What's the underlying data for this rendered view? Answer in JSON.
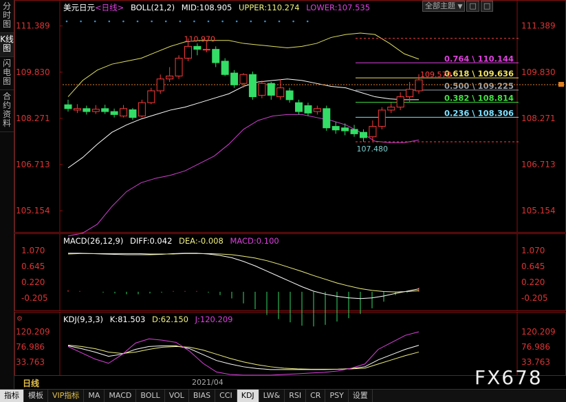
{
  "left_tabs": [
    {
      "label": "分时图",
      "active": false
    },
    {
      "label": "K线图",
      "active": true
    },
    {
      "label": "闪电图",
      "active": false
    },
    {
      "label": "合约资料",
      "active": false
    }
  ],
  "top_controls": {
    "theme_select": "全部主题",
    "chevron": "▼",
    "btn1": "□",
    "btn2": "□"
  },
  "main_panel": {
    "symbol": "美元日元",
    "period_tag": "<日线>",
    "boll_label": "BOLL(21,2)",
    "mid_label": "MID:108.905",
    "upper_label": "UPPER:110.274",
    "lower_label": "LOWER:107.535",
    "y_ticks": [
      "111.389",
      "109.830",
      "108.271",
      "106.713",
      "105.154"
    ],
    "high_annotation": "110.970",
    "low_annotation": "107.480",
    "last_price_label": "109.570"
  },
  "fib_levels": [
    {
      "label": "0.764 \\ 110.144",
      "color": "#e040e0"
    },
    {
      "label": "0.618 \\ 109.636",
      "color": "#f0e060"
    },
    {
      "label": "0.500 \\ 109.225",
      "color": "#9aa0a8"
    },
    {
      "label": "0.382 \\ 108.814",
      "color": "#40e040"
    },
    {
      "label": "0.236 \\ 108.306",
      "color": "#7fe0ff"
    }
  ],
  "macd_panel": {
    "title": "MACD(26,12,9)",
    "diff": "DIFF:0.042",
    "dea": "DEA:-0.008",
    "macd": "MACD:0.100",
    "y_ticks": [
      "1.070",
      "0.645",
      "0.220",
      "-0.205"
    ]
  },
  "kdj_panel": {
    "title": "KDJ(9,3,3)",
    "k": "K:81.503",
    "d": "D:62.150",
    "j": "J:120.209",
    "y_ticks": [
      "120.209",
      "76.986",
      "33.763"
    ]
  },
  "period_label": "日线",
  "date_label": "2021/04",
  "bottom_tabs": [
    {
      "label": "指标",
      "active": true,
      "vip": false
    },
    {
      "label": "模板",
      "active": false,
      "vip": false
    },
    {
      "label": "VIP指标",
      "active": false,
      "vip": true
    },
    {
      "label": "MA",
      "active": false,
      "vip": false
    },
    {
      "label": "MACD",
      "active": false,
      "vip": false
    },
    {
      "label": "BOLL",
      "active": false,
      "vip": false
    },
    {
      "label": "VOL",
      "active": false,
      "vip": false
    },
    {
      "label": "BIAS",
      "active": false,
      "vip": false
    },
    {
      "label": "CCI",
      "active": false,
      "vip": false
    },
    {
      "label": "KDJ",
      "active": true,
      "vip": false
    },
    {
      "label": "LW&",
      "active": false,
      "vip": false
    },
    {
      "label": "RSI",
      "active": false,
      "vip": false
    },
    {
      "label": "CR",
      "active": false,
      "vip": false
    },
    {
      "label": "PSY",
      "active": false,
      "vip": false
    },
    {
      "label": "设置",
      "active": false,
      "vip": false
    }
  ],
  "watermark": "FX678",
  "colors": {
    "up": "#ff3a3a",
    "down": "#33dd66",
    "mid": "#ffffff",
    "upper": "#e0e060",
    "lower": "#d040d0",
    "diff": "#ffffff",
    "dea": "#f0f080",
    "macd": "#e040e0",
    "k": "#ffffff",
    "d": "#f0f080",
    "j": "#e040e0"
  },
  "chart_data": [
    {
      "type": "candlestick",
      "title": "美元日元<日线>",
      "ylim": [
        104.6,
        111.8
      ],
      "y_ticks": [
        111.389,
        109.83,
        108.271,
        106.713,
        105.154
      ],
      "candles": [
        [
          108.73,
          108.6,
          108.9,
          108.5
        ],
        [
          108.55,
          108.6,
          108.75,
          108.45
        ],
        [
          108.6,
          108.5,
          108.7,
          108.4
        ],
        [
          108.5,
          108.58,
          108.72,
          108.42
        ],
        [
          108.6,
          108.5,
          108.73,
          108.42
        ],
        [
          108.5,
          108.4,
          108.6,
          108.3
        ],
        [
          108.35,
          108.6,
          108.72,
          108.3
        ],
        [
          108.56,
          108.3,
          108.62,
          108.22
        ],
        [
          108.35,
          108.8,
          108.9,
          108.3
        ],
        [
          108.8,
          109.2,
          109.3,
          108.75
        ],
        [
          109.2,
          109.6,
          109.75,
          109.1
        ],
        [
          109.6,
          109.7,
          110.0,
          109.5
        ],
        [
          109.7,
          110.3,
          110.4,
          109.6
        ],
        [
          110.3,
          110.7,
          110.97,
          110.2
        ],
        [
          110.7,
          110.6,
          110.8,
          110.4
        ],
        [
          110.6,
          110.6,
          110.9,
          110.5
        ],
        [
          110.6,
          110.15,
          110.7,
          110.0
        ],
        [
          110.2,
          109.75,
          110.3,
          109.7
        ],
        [
          109.8,
          109.4,
          109.9,
          109.3
        ],
        [
          109.45,
          109.75,
          109.8,
          109.3
        ],
        [
          109.75,
          109.0,
          109.85,
          108.9
        ],
        [
          109.05,
          109.45,
          109.55,
          108.95
        ],
        [
          109.45,
          109.05,
          109.5,
          108.9
        ],
        [
          109.0,
          109.3,
          109.6,
          108.9
        ],
        [
          109.2,
          108.9,
          109.3,
          108.8
        ],
        [
          108.8,
          108.5,
          108.9,
          108.4
        ],
        [
          108.7,
          108.45,
          108.8,
          108.35
        ],
        [
          108.5,
          108.6,
          108.7,
          108.4
        ],
        [
          108.6,
          107.95,
          108.7,
          107.85
        ],
        [
          108.0,
          107.88,
          108.15,
          107.75
        ],
        [
          107.95,
          107.85,
          108.1,
          107.7
        ],
        [
          107.9,
          107.75,
          108.05,
          107.65
        ],
        [
          107.8,
          107.62,
          107.9,
          107.48
        ],
        [
          107.65,
          108.0,
          108.2,
          107.5
        ],
        [
          108.0,
          108.55,
          108.65,
          107.9
        ],
        [
          108.55,
          108.65,
          108.8,
          108.45
        ],
        [
          108.65,
          109.0,
          109.15,
          108.55
        ],
        [
          109.0,
          109.25,
          109.5,
          108.8
        ],
        [
          109.2,
          109.57,
          109.76,
          109.1
        ]
      ],
      "bollinger": {
        "mid": [
          106.6,
          106.95,
          107.4,
          107.8,
          108.05,
          108.25,
          108.4,
          108.55,
          108.65,
          108.8,
          108.95,
          109.1,
          109.35,
          109.5,
          109.55,
          109.6,
          109.55,
          109.45,
          109.35,
          109.3,
          109.15,
          109.0,
          108.93,
          108.9,
          108.9
        ],
        "upper": [
          109.0,
          109.55,
          109.9,
          110.1,
          110.2,
          110.3,
          110.5,
          110.7,
          110.85,
          110.9,
          110.9,
          110.9,
          110.8,
          110.75,
          110.7,
          110.65,
          110.7,
          110.8,
          111.0,
          111.1,
          111.15,
          111.1,
          110.8,
          110.45,
          110.27
        ],
        "lower": [
          104.3,
          104.4,
          104.7,
          105.3,
          105.8,
          106.1,
          106.25,
          106.35,
          106.5,
          106.75,
          107.0,
          107.4,
          107.9,
          108.2,
          108.35,
          108.4,
          108.4,
          108.3,
          108.2,
          108.05,
          107.8,
          107.5,
          107.45,
          107.45,
          107.54
        ]
      },
      "fibonacci": [
        {
          "ratio": 0.764,
          "value": 110.144
        },
        {
          "ratio": 0.618,
          "value": 109.636
        },
        {
          "ratio": 0.5,
          "value": 109.225
        },
        {
          "ratio": 0.382,
          "value": 108.814
        },
        {
          "ratio": 0.236,
          "value": 108.306
        }
      ],
      "fib_range": {
        "high": 110.97,
        "low": 107.48
      },
      "last_price": 109.57
    },
    {
      "type": "line",
      "title": "MACD(26,12,9)",
      "ylim": [
        -0.52,
        1.22
      ],
      "y_ticks": [
        1.07,
        0.645,
        0.22,
        -0.205
      ],
      "series": [
        {
          "name": "DIFF",
          "values": [
            1.0,
            1.0,
            0.99,
            0.98,
            0.97,
            0.96,
            0.96,
            0.96,
            0.97,
            0.99,
            1.0,
            1.0,
            0.98,
            0.94,
            0.88,
            0.78,
            0.66,
            0.52,
            0.38,
            0.24,
            0.1,
            -0.02,
            -0.1,
            -0.16,
            -0.2,
            -0.22,
            -0.2,
            -0.15,
            -0.08,
            -0.02,
            0.042
          ]
        },
        {
          "name": "DEA",
          "values": [
            0.98,
            0.99,
            0.99,
            0.99,
            0.99,
            0.99,
            0.99,
            0.98,
            0.98,
            0.98,
            0.99,
            0.99,
            0.99,
            0.98,
            0.96,
            0.92,
            0.87,
            0.8,
            0.71,
            0.61,
            0.51,
            0.4,
            0.3,
            0.2,
            0.12,
            0.05,
            0.0,
            -0.03,
            -0.04,
            -0.03,
            -0.008
          ]
        },
        {
          "name": "MACD",
          "values": [
            0.04,
            0.02,
            0.0,
            -0.02,
            -0.04,
            -0.06,
            -0.06,
            -0.04,
            -0.02,
            0.02,
            0.02,
            0.02,
            -0.02,
            -0.08,
            -0.16,
            -0.28,
            -0.42,
            -0.56,
            -0.66,
            -0.74,
            -0.82,
            -0.84,
            -0.8,
            -0.72,
            -0.64,
            -0.54,
            -0.4,
            -0.24,
            -0.08,
            -0.02,
            0.1
          ]
        }
      ]
    },
    {
      "type": "line",
      "title": "KDJ(9,3,3)",
      "ylim": [
        -8,
        140
      ],
      "y_ticks": [
        120.209,
        76.986,
        33.763
      ],
      "series": [
        {
          "name": "K",
          "values": [
            80,
            72,
            62,
            50,
            56,
            70,
            78,
            80,
            80,
            72,
            55,
            38,
            28,
            20,
            15,
            12,
            12,
            12,
            12,
            12,
            13,
            15,
            20,
            40,
            55,
            70,
            81.5
          ]
        },
        {
          "name": "D",
          "values": [
            82,
            78,
            72,
            62,
            58,
            62,
            70,
            76,
            78,
            76,
            68,
            56,
            44,
            34,
            26,
            20,
            16,
            14,
            13,
            13,
            13,
            14,
            16,
            28,
            40,
            52,
            62.15
          ]
        },
        {
          "name": "J",
          "values": [
            78,
            60,
            42,
            30,
            55,
            88,
            100,
            96,
            90,
            65,
            30,
            5,
            -2,
            -5,
            -6,
            -4,
            -2,
            0,
            2,
            4,
            8,
            16,
            28,
            70,
            90,
            110,
            120.2
          ]
        }
      ]
    }
  ]
}
